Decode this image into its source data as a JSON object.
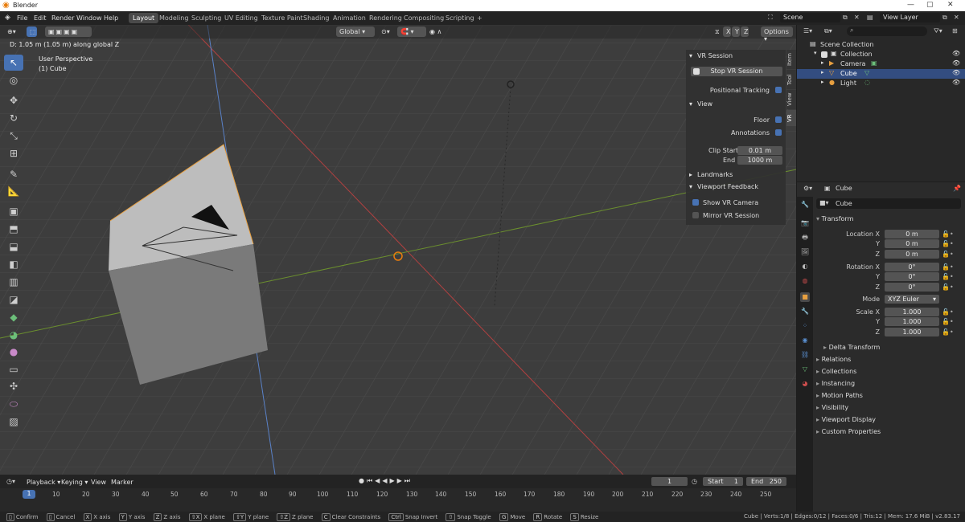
{
  "window": {
    "title": "Blender",
    "min": "—",
    "max": "▢",
    "close": "✕"
  },
  "menu": [
    "File",
    "Edit",
    "Render",
    "Window",
    "Help"
  ],
  "workspaces": [
    "Layout",
    "Modeling",
    "Sculpting",
    "UV Editing",
    "Texture Paint",
    "Shading",
    "Animation",
    "Rendering",
    "Compositing",
    "Scripting",
    "+"
  ],
  "scene": {
    "label": "Scene",
    "view_layer": "View Layer"
  },
  "viewport": {
    "orientation": "Global",
    "options": "Options",
    "x": "X",
    "y": "Y",
    "z": "Z",
    "overlay_text": "D: 1.05 m (1.05 m) along global Z",
    "perspective": "User Perspective",
    "object": "(1) Cube"
  },
  "vr_panel": {
    "session_header": "VR Session",
    "stop_button": "Stop VR Session",
    "positional_tracking": "Positional Tracking",
    "view_header": "View",
    "floor": "Floor",
    "annotations": "Annotations",
    "clip_start_label": "Clip Start",
    "clip_start": "0.01 m",
    "end_label": "End",
    "end": "1000 m",
    "landmarks": "Landmarks",
    "feedback_header": "Viewport Feedback",
    "show_vr_camera": "Show VR Camera",
    "mirror_vr_session": "Mirror VR Session"
  },
  "side_tabs": [
    "Item",
    "Tool",
    "View",
    "VR"
  ],
  "outliner": {
    "search_placeholder": "",
    "root": "Scene Collection",
    "collection": "Collection",
    "items": [
      "Camera",
      "Cube",
      "Light"
    ]
  },
  "properties": {
    "object_name": "Cube",
    "name_field": "Cube",
    "transform": "Transform",
    "location_x": "Location X",
    "rotation_x": "Rotation X",
    "scale_x": "Scale X",
    "y": "Y",
    "z": "Z",
    "loc": [
      "0 m",
      "0 m",
      "0 m"
    ],
    "rot": [
      "0°",
      "0°",
      "0°"
    ],
    "mode_label": "Mode",
    "mode": "XYZ Euler",
    "scale": [
      "1.000",
      "1.000",
      "1.000"
    ],
    "delta": "Delta Transform",
    "sections": [
      "Relations",
      "Collections",
      "Instancing",
      "Motion Paths",
      "Visibility",
      "Viewport Display",
      "Custom Properties"
    ]
  },
  "timeline": {
    "menu": [
      "Playback",
      "Keying",
      "View",
      "Marker"
    ],
    "current": "1",
    "start_label": "Start",
    "start": "1",
    "end_label": "End",
    "end": "250",
    "frame_marker": "1",
    "ticks": [
      "10",
      "20",
      "30",
      "40",
      "50",
      "60",
      "70",
      "80",
      "90",
      "100",
      "110",
      "120",
      "130",
      "140",
      "150",
      "160",
      "170",
      "180",
      "190",
      "200",
      "210",
      "220",
      "230",
      "240",
      "250"
    ]
  },
  "status": {
    "items": [
      [
        "",
        "Confirm"
      ],
      [
        "",
        "Cancel"
      ],
      [
        "X",
        "X axis"
      ],
      [
        "Y",
        "Y axis"
      ],
      [
        "Z",
        "Z axis"
      ],
      [
        "⇧X",
        "X plane"
      ],
      [
        "⇧Y",
        "Y plane"
      ],
      [
        "⇧Z",
        "Z plane"
      ],
      [
        "C",
        "Clear Constraints"
      ],
      [
        "Ctrl",
        "Snap Invert"
      ],
      [
        "",
        "Snap Toggle"
      ],
      [
        "G",
        "Move"
      ],
      [
        "R",
        "Rotate"
      ],
      [
        "S",
        "Resize"
      ]
    ],
    "info": "Cube | Verts:1/8 | Edges:0/12 | Faces:0/6 | Tris:12 | Mem: 17.6 MiB | v2.83.17"
  },
  "colors": {
    "accent": "#4772b3",
    "selected_row": "#334d80",
    "x_axis": "#b34040",
    "y_axis": "#6b8f2e",
    "z_axis": "#5a82c8"
  }
}
